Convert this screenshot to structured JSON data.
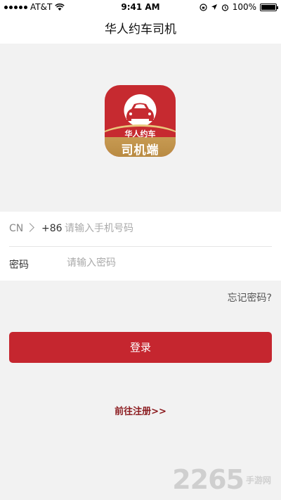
{
  "status": {
    "carrier": "AT&T",
    "time": "9:41 AM",
    "battery": "100%",
    "battery_level": 1.0
  },
  "nav": {
    "title": "华人约车司机"
  },
  "logo": {
    "line1": "华人约车",
    "line2": "司机端"
  },
  "form": {
    "country_code": "CN",
    "dial_code": "+86",
    "phone_placeholder": "请输入手机号码",
    "password_label": "密码",
    "password_placeholder": "请输入密码"
  },
  "forgot_label": "忘记密码?",
  "login_label": "登录",
  "register_label": "前往注册>>",
  "watermark": {
    "number": "2265",
    "text": "手游网"
  },
  "colors": {
    "accent": "#c5262f",
    "link": "#8b1a1e",
    "gold": "#c79a52"
  }
}
